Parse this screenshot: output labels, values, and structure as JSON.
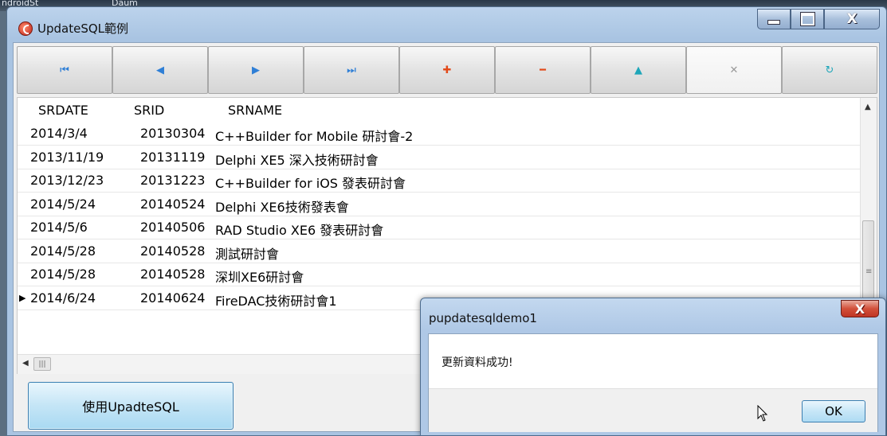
{
  "desktop": {
    "bg_labels": [
      "ndroidSt",
      "Daum"
    ]
  },
  "window": {
    "title": "UpdateSQL範例",
    "controls": {
      "minimize": "_",
      "maximize": "□",
      "close": "X"
    }
  },
  "navigator": {
    "buttons": [
      {
        "name": "first",
        "glyph": "⏮"
      },
      {
        "name": "prior",
        "glyph": "◀"
      },
      {
        "name": "next",
        "glyph": "▶"
      },
      {
        "name": "last",
        "glyph": "⏭"
      },
      {
        "name": "insert",
        "glyph": "✚"
      },
      {
        "name": "delete",
        "glyph": "━"
      },
      {
        "name": "edit",
        "glyph": "▲"
      },
      {
        "name": "cancel",
        "glyph": "✕"
      },
      {
        "name": "refresh",
        "glyph": "↻"
      }
    ]
  },
  "grid": {
    "columns": [
      "SRDATE",
      "SRID",
      "SRNAME"
    ],
    "rows": [
      {
        "srdate": "2014/3/4",
        "srid": "20130304",
        "srname": "C++Builder for Mobile 研討會-2"
      },
      {
        "srdate": "2013/11/19",
        "srid": "20131119",
        "srname": "Delphi XE5 深入技術研討會"
      },
      {
        "srdate": "2013/12/23",
        "srid": "20131223",
        "srname": "C++Builder for iOS 發表研討會"
      },
      {
        "srdate": "2014/5/24",
        "srid": "20140524",
        "srname": "Delphi XE6技術發表會"
      },
      {
        "srdate": "2014/5/6",
        "srid": "20140506",
        "srname": "RAD Studio XE6 發表研討會"
      },
      {
        "srdate": "2014/5/28",
        "srid": "20140528",
        "srname": "測試研討會"
      },
      {
        "srdate": "2014/5/28",
        "srid": "20140528",
        "srname": "深圳XE6研討會"
      },
      {
        "srdate": "2014/6/24",
        "srid": "20140624",
        "srname": "FireDAC技術研討會1"
      }
    ],
    "current_row_indicator": "▶",
    "scroll": {
      "up": "▲",
      "left": "◀",
      "thumb_grip": "|||"
    }
  },
  "action_button": {
    "label": "使用UpadteSQL"
  },
  "dialog": {
    "title": "pupdatesqldemo1",
    "close": "X",
    "message": "更新資料成功!",
    "ok_label": "OK"
  }
}
